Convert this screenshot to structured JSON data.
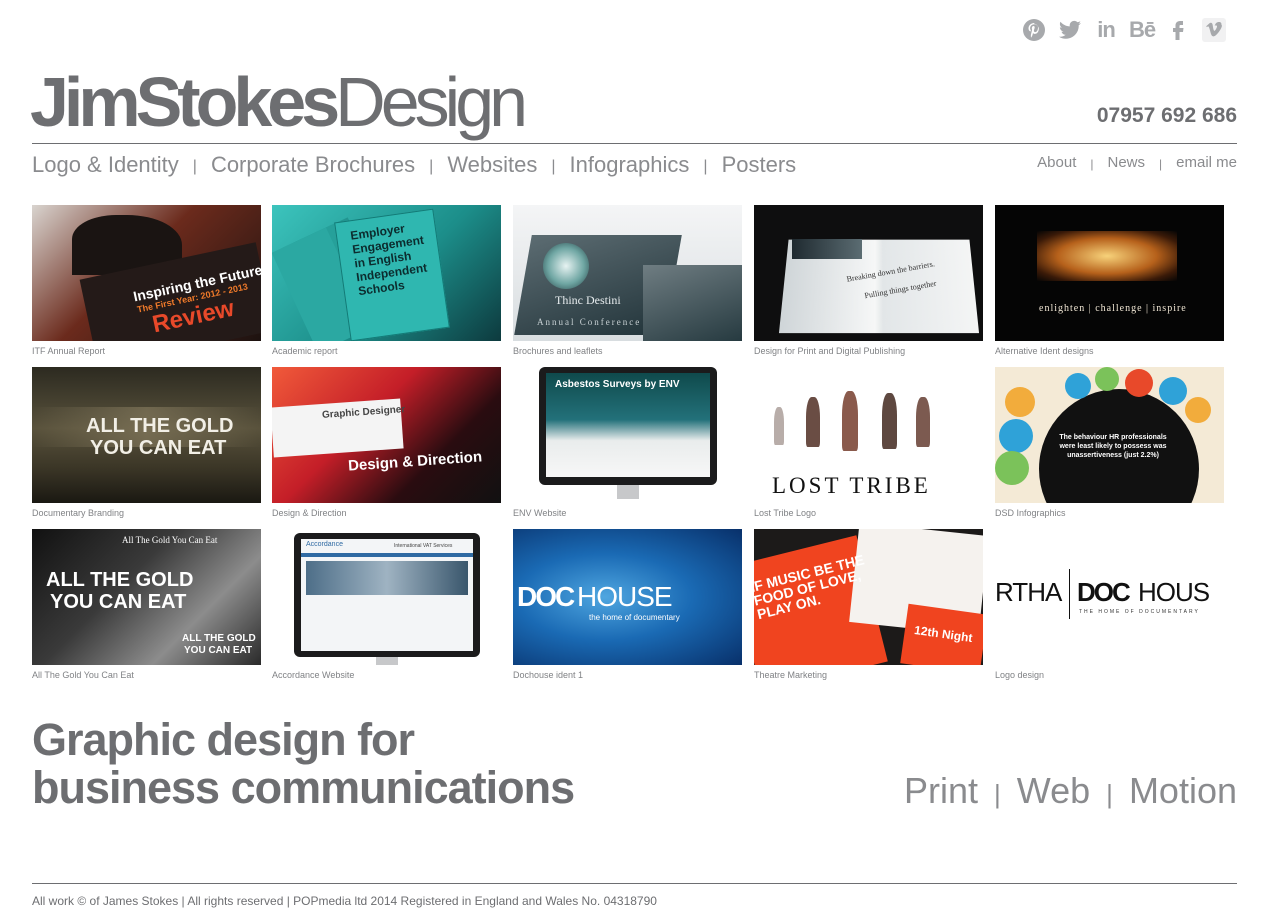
{
  "header": {
    "social": [
      "pinterest-icon",
      "twitter-icon",
      "linkedin-icon",
      "behance-icon",
      "facebook-icon",
      "vimeo-icon"
    ],
    "linkedin_text": "in",
    "behance_text": "Bē",
    "logo_bold": "JimStokes",
    "logo_light": "Design",
    "phone": "07957 692 686"
  },
  "nav": {
    "main": [
      "Logo & Identity",
      "Corporate Brochures",
      "Websites",
      "Infographics",
      "Posters"
    ],
    "secondary": [
      "About",
      "News",
      "email me"
    ],
    "separator": "|"
  },
  "portfolio": [
    {
      "caption": "ITF Annual Report",
      "lines": [
        "Inspiring the Future",
        "The First Year: 2012 - 2013",
        "Review"
      ]
    },
    {
      "caption": "Academic report",
      "lines": [
        "Employer Engagement in English Independent Schools"
      ]
    },
    {
      "caption": "Brochures and leaflets",
      "lines": [
        "Thinc Destini",
        "Annual Conference"
      ]
    },
    {
      "caption": "Design for Print and Digital Publishing",
      "lines": [
        "Breaking down the barriers.",
        "Pulling things together"
      ]
    },
    {
      "caption": "Alternative Ident designs",
      "lines": [
        "enlighten  |  challenge  |  inspire"
      ]
    },
    {
      "caption": "Documentary Branding",
      "lines": [
        "ALL THE GOLD",
        "YOU CAN EAT"
      ]
    },
    {
      "caption": "Design & Direction",
      "lines": [
        "Design & Direction",
        "Graphic Designer"
      ]
    },
    {
      "caption": "ENV Website",
      "lines": [
        "Asbestos Surveys by ENV"
      ]
    },
    {
      "caption": "Lost Tribe Logo",
      "lines": [
        "LOST TRIBE"
      ]
    },
    {
      "caption": "DSD Infographics",
      "lines": [
        "The behaviour HR professionals were least likely to possess was unassertiveness (just 2.2%)"
      ]
    },
    {
      "caption": "All The Gold You Can Eat",
      "lines": [
        "ALL THE GOLD",
        "YOU CAN EAT",
        "All The Gold You Can Eat"
      ]
    },
    {
      "caption": "Accordance Website",
      "lines": [
        "Accordance",
        "International VAT Services"
      ]
    },
    {
      "caption": "Dochouse ident 1",
      "lines": [
        "DOC",
        "HOUSE",
        "the home of documentary"
      ]
    },
    {
      "caption": "Theatre Marketing",
      "lines": [
        "IF MUSIC BE THE FOOD OF LOVE, PLAY ON.",
        "12th Night"
      ]
    },
    {
      "caption": "Logo design",
      "lines": [
        "RTHA",
        "DOC",
        "HOUS",
        "THE HOME OF DOCUMENTARY"
      ]
    }
  ],
  "tagline": {
    "line1": "Graphic design for",
    "line2": "business communications"
  },
  "services": [
    "Print",
    "Web",
    "Motion"
  ],
  "footer": "All work © of James Stokes | All rights reserved | POPmedia ltd 2014 Registered in England and Wales No. 04318790",
  "colors": {
    "text": "#6d6e71",
    "nav": "#8a8b8e",
    "icon": "#a7a9ac",
    "accent_orange": "#e8492a",
    "teal": "#1e8f8a",
    "dochouse_blue": "#0a5fa8"
  }
}
